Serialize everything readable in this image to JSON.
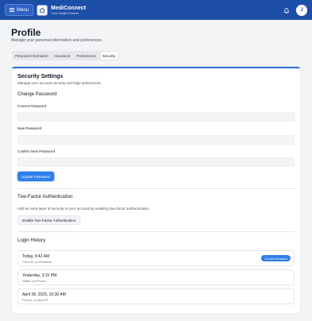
{
  "header": {
    "menu_label": "Menu",
    "app_name": "MediConnect",
    "tagline": "Your Health Partner",
    "avatar_initial": "J",
    "icons": {
      "menu": "menu-icon",
      "home": "home-icon",
      "notifications": "bell-icon"
    },
    "colors": {
      "bar": "#1e4fa8",
      "accent": "#2f80ed"
    }
  },
  "page": {
    "title": "Profile",
    "subtitle": "Manage your personal information and preferences."
  },
  "tabs": [
    {
      "label": "Personal Information",
      "active": false
    },
    {
      "label": "Insurance",
      "active": false
    },
    {
      "label": "Preferences",
      "active": false
    },
    {
      "label": "Security",
      "active": true
    }
  ],
  "security": {
    "title": "Security Settings",
    "subtitle": "Manage your account security and login preferences.",
    "change_password": {
      "heading": "Change Password",
      "current_label": "Current Password",
      "new_label": "New Password",
      "confirm_label": "Confirm New Password",
      "current_value": "",
      "new_value": "",
      "confirm_value": "",
      "button": "Update Password"
    },
    "two_factor": {
      "heading": "Two-Factor Authentication",
      "description": "Add an extra layer of security to your account by enabling two-factor authentication.",
      "button": "Enable Two-Factor Authentication"
    },
    "login_history": {
      "heading": "Login History",
      "sessions": [
        {
          "time": "Today, 9:42 AM",
          "device": "Chrome on Windows",
          "badge": "Current Session"
        },
        {
          "time": "Yesterday, 3:15 PM",
          "device": "Safari on iPhone",
          "badge": ""
        },
        {
          "time": "April 28, 2025, 10:30 AM",
          "device": "Firefox on MacOS",
          "badge": ""
        }
      ]
    }
  }
}
